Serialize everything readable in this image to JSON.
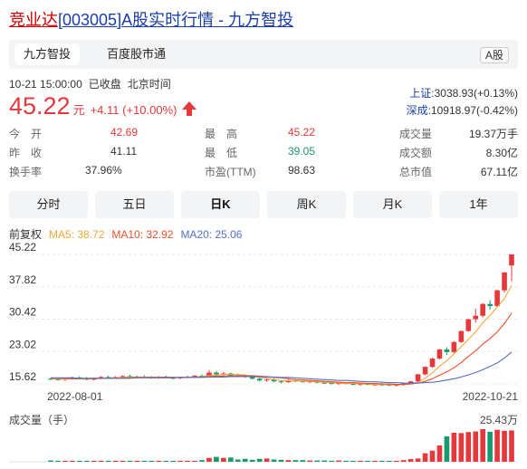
{
  "title": {
    "name": "竞业达",
    "code": "[003005]",
    "suffix": "A股实时行情",
    "sep": " - ",
    "site": "九方智投"
  },
  "tabs": [
    {
      "label": "九方智投"
    },
    {
      "label": "百度股市通"
    }
  ],
  "market_badge": "A股",
  "meta": {
    "time": "10-21 15:00:00",
    "status": "已收盘",
    "tz": "北京时间"
  },
  "quote": {
    "price": "45.22",
    "unit": "元",
    "change": "+4.11 (+10.00%)"
  },
  "indices": [
    {
      "label": "上证:",
      "value": "3038.93(+0.13%)"
    },
    {
      "label": "深成:",
      "value": "10918.97(-0.42%)"
    }
  ],
  "stats": {
    "open": {
      "label": "今　开",
      "value": "42.69"
    },
    "prev": {
      "label": "昨　收",
      "value": "41.11"
    },
    "turnover": {
      "label": "换手率",
      "value": "37.96%"
    },
    "high": {
      "label": "最　高",
      "value": "45.22"
    },
    "low": {
      "label": "最　低",
      "value": "39.05"
    },
    "pe": {
      "label": "市盈(TTM)",
      "value": "98.63"
    },
    "volume": {
      "label": "成交量",
      "value": "19.37万手"
    },
    "amount": {
      "label": "成交额",
      "value": "8.30亿"
    },
    "mcap": {
      "label": "总市值",
      "value": "67.11亿"
    }
  },
  "periods": [
    {
      "label": "分时"
    },
    {
      "label": "五日"
    },
    {
      "label": "日K"
    },
    {
      "label": "周K"
    },
    {
      "label": "月K"
    },
    {
      "label": "1年"
    }
  ],
  "adjust_label": "前复权",
  "ma": [
    {
      "label": "MA5: 38.72",
      "color": "#f3a73b"
    },
    {
      "label": "MA10: 32.92",
      "color": "#e8502a"
    },
    {
      "label": "MA20: 25.06",
      "color": "#5470c6"
    }
  ],
  "colors": {
    "up": "#e4393c",
    "down": "#1a9a6c",
    "accent": "#1a3ea6"
  },
  "chart_data": {
    "type": "candlestick",
    "y_ticks": [
      "45.22",
      "37.82",
      "30.42",
      "23.02",
      "15.62"
    ],
    "ylim": [
      15.62,
      45.22
    ],
    "x_ticks": [
      "2022-08-01",
      "2022-10-21"
    ],
    "volume_label": "成交量（手）",
    "volume_max_label": "25.43万",
    "candles": [
      {
        "o": 16.8,
        "h": 17.1,
        "l": 16.5,
        "c": 16.7
      },
      {
        "o": 16.7,
        "h": 17.0,
        "l": 16.4,
        "c": 16.6
      },
      {
        "o": 16.6,
        "h": 17.0,
        "l": 16.3,
        "c": 16.8
      },
      {
        "o": 16.8,
        "h": 17.3,
        "l": 16.6,
        "c": 17.1
      },
      {
        "o": 17.1,
        "h": 17.4,
        "l": 16.8,
        "c": 16.9
      },
      {
        "o": 16.9,
        "h": 17.2,
        "l": 16.5,
        "c": 16.6
      },
      {
        "o": 16.6,
        "h": 17.1,
        "l": 16.4,
        "c": 16.9
      },
      {
        "o": 16.9,
        "h": 17.4,
        "l": 16.7,
        "c": 17.2
      },
      {
        "o": 17.2,
        "h": 17.5,
        "l": 16.9,
        "c": 17.0
      },
      {
        "o": 17.0,
        "h": 17.4,
        "l": 16.8,
        "c": 17.2
      },
      {
        "o": 17.2,
        "h": 17.6,
        "l": 17.0,
        "c": 17.4
      },
      {
        "o": 17.4,
        "h": 17.7,
        "l": 17.0,
        "c": 17.1
      },
      {
        "o": 17.1,
        "h": 17.5,
        "l": 16.9,
        "c": 17.3
      },
      {
        "o": 17.3,
        "h": 17.6,
        "l": 17.0,
        "c": 17.1
      },
      {
        "o": 17.1,
        "h": 17.4,
        "l": 16.8,
        "c": 17.0
      },
      {
        "o": 17.0,
        "h": 17.4,
        "l": 16.8,
        "c": 17.2
      },
      {
        "o": 17.2,
        "h": 17.5,
        "l": 16.9,
        "c": 17.0
      },
      {
        "o": 17.0,
        "h": 17.3,
        "l": 16.7,
        "c": 16.9
      },
      {
        "o": 16.9,
        "h": 17.3,
        "l": 16.7,
        "c": 17.1
      },
      {
        "o": 17.1,
        "h": 17.5,
        "l": 16.9,
        "c": 17.2
      },
      {
        "o": 17.2,
        "h": 17.6,
        "l": 17.0,
        "c": 17.5
      },
      {
        "o": 17.5,
        "h": 17.8,
        "l": 17.2,
        "c": 17.4
      },
      {
        "o": 17.4,
        "h": 18.8,
        "l": 17.3,
        "c": 18.2
      },
      {
        "o": 18.2,
        "h": 18.6,
        "l": 17.6,
        "c": 17.8
      },
      {
        "o": 17.8,
        "h": 18.4,
        "l": 17.5,
        "c": 18.0
      },
      {
        "o": 18.0,
        "h": 18.2,
        "l": 17.4,
        "c": 17.6
      },
      {
        "o": 17.6,
        "h": 18.0,
        "l": 17.2,
        "c": 17.4
      },
      {
        "o": 17.4,
        "h": 17.8,
        "l": 17.0,
        "c": 17.2
      },
      {
        "o": 17.2,
        "h": 17.5,
        "l": 16.6,
        "c": 16.8
      },
      {
        "o": 16.8,
        "h": 17.0,
        "l": 16.2,
        "c": 16.4
      },
      {
        "o": 16.4,
        "h": 16.9,
        "l": 16.1,
        "c": 16.6
      },
      {
        "o": 16.6,
        "h": 16.9,
        "l": 16.0,
        "c": 16.2
      },
      {
        "o": 16.2,
        "h": 16.5,
        "l": 15.8,
        "c": 16.0
      },
      {
        "o": 16.0,
        "h": 16.6,
        "l": 15.9,
        "c": 16.4
      },
      {
        "o": 16.4,
        "h": 16.7,
        "l": 16.0,
        "c": 16.2
      },
      {
        "o": 16.2,
        "h": 16.5,
        "l": 15.9,
        "c": 16.0
      },
      {
        "o": 16.0,
        "h": 16.4,
        "l": 15.8,
        "c": 16.2
      },
      {
        "o": 16.2,
        "h": 16.4,
        "l": 15.7,
        "c": 15.9
      },
      {
        "o": 15.9,
        "h": 16.2,
        "l": 15.6,
        "c": 15.8
      },
      {
        "o": 15.8,
        "h": 16.1,
        "l": 15.5,
        "c": 15.7
      },
      {
        "o": 15.7,
        "h": 16.0,
        "l": 15.4,
        "c": 15.8
      },
      {
        "o": 15.8,
        "h": 16.0,
        "l": 15.5,
        "c": 15.6
      },
      {
        "o": 15.6,
        "h": 15.9,
        "l": 15.3,
        "c": 15.5
      },
      {
        "o": 15.5,
        "h": 15.8,
        "l": 15.2,
        "c": 15.6
      },
      {
        "o": 15.6,
        "h": 15.8,
        "l": 15.3,
        "c": 15.4
      },
      {
        "o": 15.4,
        "h": 15.7,
        "l": 15.2,
        "c": 15.5
      },
      {
        "o": 15.5,
        "h": 15.8,
        "l": 15.2,
        "c": 15.4
      },
      {
        "o": 15.4,
        "h": 15.6,
        "l": 15.1,
        "c": 15.3
      },
      {
        "o": 15.3,
        "h": 15.6,
        "l": 15.0,
        "c": 15.4
      },
      {
        "o": 15.4,
        "h": 15.9,
        "l": 15.2,
        "c": 15.7
      },
      {
        "o": 15.7,
        "h": 16.3,
        "l": 15.5,
        "c": 16.2
      },
      {
        "o": 16.2,
        "h": 17.9,
        "l": 16.0,
        "c": 17.8
      },
      {
        "o": 17.8,
        "h": 19.6,
        "l": 17.6,
        "c": 19.5
      },
      {
        "o": 19.5,
        "h": 21.6,
        "l": 19.3,
        "c": 21.4
      },
      {
        "o": 21.4,
        "h": 23.6,
        "l": 21.2,
        "c": 23.5
      },
      {
        "o": 23.5,
        "h": 24.0,
        "l": 22.2,
        "c": 22.9
      },
      {
        "o": 22.9,
        "h": 25.4,
        "l": 22.7,
        "c": 25.2
      },
      {
        "o": 25.2,
        "h": 27.8,
        "l": 25.0,
        "c": 27.7
      },
      {
        "o": 27.7,
        "h": 30.5,
        "l": 27.5,
        "c": 30.4
      },
      {
        "o": 30.4,
        "h": 32.8,
        "l": 29.6,
        "c": 31.2
      },
      {
        "o": 31.2,
        "h": 34.1,
        "l": 30.8,
        "c": 33.9
      },
      {
        "o": 33.9,
        "h": 34.8,
        "l": 32.6,
        "c": 33.4
      },
      {
        "o": 33.4,
        "h": 37.2,
        "l": 33.1,
        "c": 37.0
      },
      {
        "o": 37.0,
        "h": 41.2,
        "l": 36.5,
        "c": 41.1
      },
      {
        "o": 42.69,
        "h": 45.22,
        "l": 39.05,
        "c": 45.22
      }
    ],
    "ma5": [
      16.8,
      16.8,
      16.7,
      16.8,
      16.8,
      16.8,
      16.9,
      16.9,
      17.0,
      17.0,
      17.1,
      17.2,
      17.2,
      17.2,
      17.2,
      17.2,
      17.1,
      17.1,
      17.1,
      17.1,
      17.2,
      17.3,
      17.5,
      17.6,
      17.8,
      17.8,
      17.8,
      17.6,
      17.4,
      17.1,
      16.9,
      16.6,
      16.4,
      16.3,
      16.3,
      16.2,
      16.2,
      16.1,
      16.0,
      15.9,
      15.8,
      15.7,
      15.7,
      15.6,
      15.6,
      15.5,
      15.5,
      15.4,
      15.4,
      15.5,
      15.6,
      16.0,
      16.9,
      18.1,
      19.7,
      20.9,
      22.5,
      24.1,
      25.8,
      27.5,
      29.6,
      31.3,
      33.2,
      35.1,
      38.1
    ],
    "ma10": [
      16.9,
      16.9,
      16.9,
      16.8,
      16.8,
      16.8,
      16.8,
      16.9,
      16.9,
      16.9,
      17.0,
      17.0,
      17.1,
      17.1,
      17.1,
      17.1,
      17.2,
      17.1,
      17.1,
      17.1,
      17.1,
      17.2,
      17.3,
      17.4,
      17.4,
      17.5,
      17.5,
      17.5,
      17.5,
      17.4,
      17.3,
      17.1,
      17.0,
      16.8,
      16.6,
      16.5,
      16.4,
      16.3,
      16.2,
      16.1,
      16.0,
      15.9,
      15.9,
      15.8,
      15.7,
      15.7,
      15.6,
      15.6,
      15.5,
      15.5,
      15.6,
      15.8,
      16.2,
      16.8,
      17.6,
      18.4,
      19.3,
      20.5,
      21.9,
      23.2,
      24.7,
      26.0,
      27.5,
      29.4,
      31.8
    ],
    "ma20": [
      17.0,
      17.0,
      17.0,
      17.0,
      16.9,
      16.9,
      16.9,
      16.9,
      16.9,
      16.9,
      16.9,
      16.9,
      17.0,
      17.0,
      17.0,
      17.0,
      17.0,
      17.0,
      17.1,
      17.1,
      17.1,
      17.1,
      17.2,
      17.2,
      17.2,
      17.3,
      17.3,
      17.3,
      17.3,
      17.3,
      17.2,
      17.2,
      17.1,
      17.1,
      17.0,
      16.9,
      16.8,
      16.7,
      16.6,
      16.5,
      16.4,
      16.4,
      16.3,
      16.2,
      16.1,
      16.1,
      16.0,
      15.9,
      15.9,
      15.8,
      15.8,
      15.8,
      15.9,
      16.0,
      16.2,
      16.5,
      16.8,
      17.2,
      17.7,
      18.2,
      18.9,
      19.6,
      20.4,
      21.5,
      22.9
    ],
    "volumes": [
      0.4,
      0.3,
      0.3,
      0.3,
      0.3,
      0.3,
      0.3,
      0.3,
      0.3,
      0.3,
      0.3,
      0.3,
      0.3,
      0.3,
      0.3,
      0.3,
      0.3,
      0.3,
      0.3,
      0.3,
      0.3,
      0.5,
      1.2,
      1.5,
      1.2,
      1.3,
      0.7,
      0.9,
      0.6,
      0.9,
      1.0,
      0.7,
      0.6,
      0.5,
      0.5,
      0.5,
      0.4,
      0.4,
      0.4,
      0.3,
      0.4,
      0.3,
      0.3,
      0.3,
      0.3,
      0.3,
      0.3,
      0.3,
      0.3,
      0.5,
      0.8,
      1.0,
      2.6,
      3.4,
      5.0,
      7.8,
      8.9,
      8.8,
      9.1,
      9.3,
      10.0,
      9.2,
      9.8,
      9.5,
      9.6
    ]
  }
}
